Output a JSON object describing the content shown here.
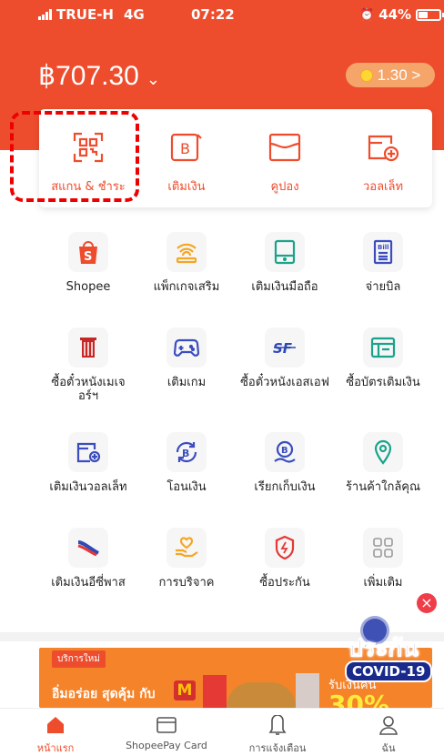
{
  "status_bar": {
    "carrier": "TRUE-H",
    "network": "4G",
    "time": "07:22",
    "battery": "44%"
  },
  "wallet": {
    "balance": "฿707.30",
    "coins": "1.30 >"
  },
  "quick_actions": [
    {
      "label": "สแกน & ชำระ",
      "icon": "scan-qr-icon"
    },
    {
      "label": "เติมเงิน",
      "icon": "topup-icon"
    },
    {
      "label": "คูปอง",
      "icon": "coupon-icon"
    },
    {
      "label": "วอลเล็ท",
      "icon": "wallet-icon"
    }
  ],
  "services": [
    [
      {
        "label": "Shopee",
        "icon": "shopee-bag-icon"
      },
      {
        "label": "แพ็กเกจเสริม",
        "icon": "wifi-package-icon"
      },
      {
        "label": "เติมเงินมือถือ",
        "icon": "mobile-topup-icon"
      },
      {
        "label": "จ่ายบิล",
        "icon": "bill-icon"
      }
    ],
    [
      {
        "label": "ซื้อตั๋วหนังเมเจอร์ฯ",
        "icon": "major-cinema-icon"
      },
      {
        "label": "เติมเกม",
        "icon": "gamepad-icon"
      },
      {
        "label": "ซื้อตั๋วหนังเอสเอฟ",
        "icon": "sf-cinema-icon"
      },
      {
        "label": "ซื้อบัตรเติมเงิน",
        "icon": "prepaid-card-icon"
      }
    ],
    [
      {
        "label": "เติมเงินวอลเล็ท",
        "icon": "wallet-topup-icon"
      },
      {
        "label": "โอนเงิน",
        "icon": "transfer-icon"
      },
      {
        "label": "เรียกเก็บเงิน",
        "icon": "request-money-icon"
      },
      {
        "label": "ร้านค้าใกล้คุณ",
        "icon": "location-pin-icon"
      }
    ],
    [
      {
        "label": "เติมเงินอีซี่พาส",
        "icon": "easy-pass-icon"
      },
      {
        "label": "การบริจาค",
        "icon": "donation-icon"
      },
      {
        "label": "ซื้อประกัน",
        "icon": "insurance-shield-icon"
      },
      {
        "label": "เพิ่มเติม",
        "icon": "more-grid-icon"
      }
    ]
  ],
  "banner": {
    "tag": "บริการใหม่",
    "headline": "อิ่มอร่อย สุดคุ้ม กับ",
    "brand_mark": "M",
    "right_text": "รับเงินคืน",
    "percent": "30%"
  },
  "covid_badge": {
    "line1": "ประกัน",
    "line2": "COVID-19",
    "close": "×"
  },
  "tabs": [
    {
      "label": "หน้าแรก",
      "icon": "home-icon",
      "active": true
    },
    {
      "label": "ShopeePay Card",
      "icon": "card-icon",
      "active": false
    },
    {
      "label": "การแจ้งเตือน",
      "icon": "bell-icon",
      "active": false
    },
    {
      "label": "ฉัน",
      "icon": "user-icon",
      "active": false
    }
  ],
  "colors": {
    "brand": "#ee4d2d",
    "coin_pill": "#f5a56a",
    "grid_icon_bg": "#f6f6f6",
    "highlight": "#e00000"
  }
}
